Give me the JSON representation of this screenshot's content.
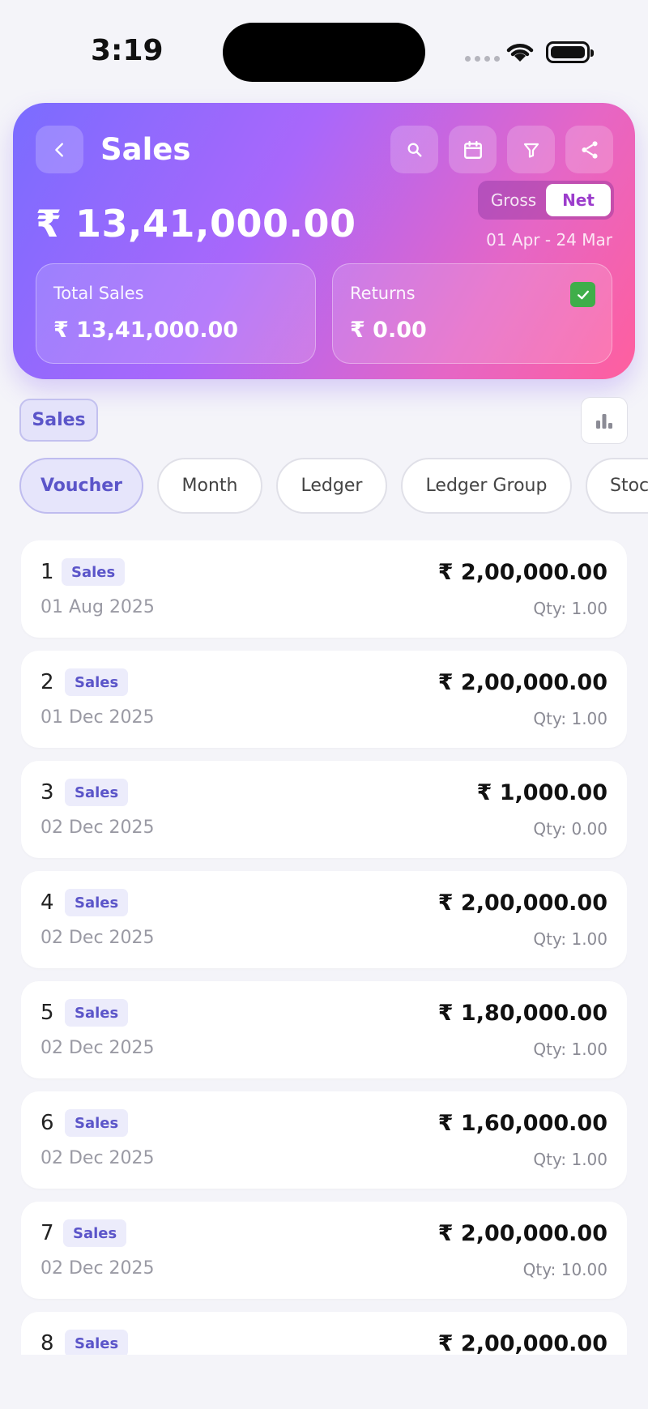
{
  "status_bar": {
    "time": "3:19"
  },
  "header": {
    "title": "Sales",
    "total_amount": "₹ 13,41,000.00",
    "toggle": {
      "gross_label": "Gross",
      "net_label": "Net",
      "selected": "Net"
    },
    "date_range": "01 Apr - 24 Mar",
    "cards": {
      "total_sales_label": "Total Sales",
      "total_sales_value": "₹ 13,41,000.00",
      "returns_label": "Returns",
      "returns_value": "₹ 0.00",
      "returns_checked": true
    },
    "icons": [
      "back-icon",
      "search-icon",
      "calendar-icon",
      "filter-icon",
      "share-icon"
    ]
  },
  "filter_chip": "Sales",
  "group_tabs": [
    {
      "label": "Voucher",
      "active": true
    },
    {
      "label": "Month",
      "active": false
    },
    {
      "label": "Ledger",
      "active": false
    },
    {
      "label": "Ledger Group",
      "active": false
    },
    {
      "label": "Stoc",
      "active": false
    }
  ],
  "vouchers": [
    {
      "no": "1",
      "type": "Sales",
      "date": "01 Aug 2025",
      "amount": "₹ 2,00,000.00",
      "qty": "Qty: 1.00"
    },
    {
      "no": "2",
      "type": "Sales",
      "date": "01 Dec 2025",
      "amount": "₹ 2,00,000.00",
      "qty": "Qty: 1.00"
    },
    {
      "no": "3",
      "type": "Sales",
      "date": "02 Dec 2025",
      "amount": "₹ 1,000.00",
      "qty": "Qty: 0.00"
    },
    {
      "no": "4",
      "type": "Sales",
      "date": "02 Dec 2025",
      "amount": "₹ 2,00,000.00",
      "qty": "Qty: 1.00"
    },
    {
      "no": "5",
      "type": "Sales",
      "date": "02 Dec 2025",
      "amount": "₹ 1,80,000.00",
      "qty": "Qty: 1.00"
    },
    {
      "no": "6",
      "type": "Sales",
      "date": "02 Dec 2025",
      "amount": "₹ 1,60,000.00",
      "qty": "Qty: 1.00"
    },
    {
      "no": "7",
      "type": "Sales",
      "date": "02 Dec 2025",
      "amount": "₹ 2,00,000.00",
      "qty": "Qty: 10.00"
    },
    {
      "no": "8",
      "type": "Sales",
      "date": "",
      "amount": "₹ 2,00,000.00",
      "qty": ""
    }
  ],
  "colors": {
    "accent": "#5b55c9",
    "gradient_start": "#7a6cff",
    "gradient_end": "#ff5f9e",
    "check": "#3fae4a"
  }
}
